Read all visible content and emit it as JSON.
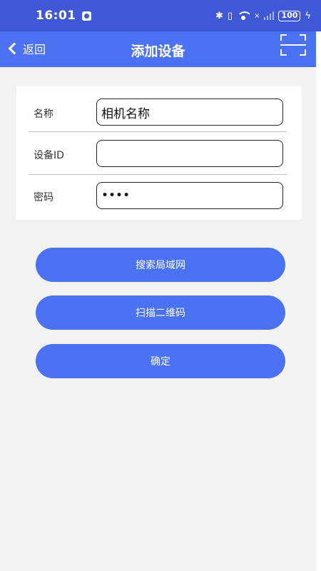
{
  "status_bar": {
    "time": "16:01",
    "bluetooth": "✱",
    "vibrate": "▯",
    "no_sim": "×",
    "battery": "100"
  },
  "header": {
    "back_label": "返回",
    "title": "添加设备"
  },
  "form": {
    "fields": [
      {
        "label": "名称",
        "value": "相机名称",
        "type": "text"
      },
      {
        "label": "设备ID",
        "value": "",
        "type": "text"
      },
      {
        "label": "密码",
        "value": "1234",
        "type": "password"
      }
    ]
  },
  "buttons": {
    "search_lan": "搜索局域网",
    "scan_qr": "扫描二维码",
    "confirm": "确定"
  },
  "colors": {
    "status_bar": "#3f59d6",
    "header": "#4a72f2",
    "button": "#4a72f2",
    "background": "#f2f2f2"
  },
  "icons": {
    "back": "chevron-left-icon",
    "scan": "scan-frame-icon",
    "wifi": "wifi-icon",
    "signal": "signal-icon",
    "battery": "battery-icon"
  }
}
